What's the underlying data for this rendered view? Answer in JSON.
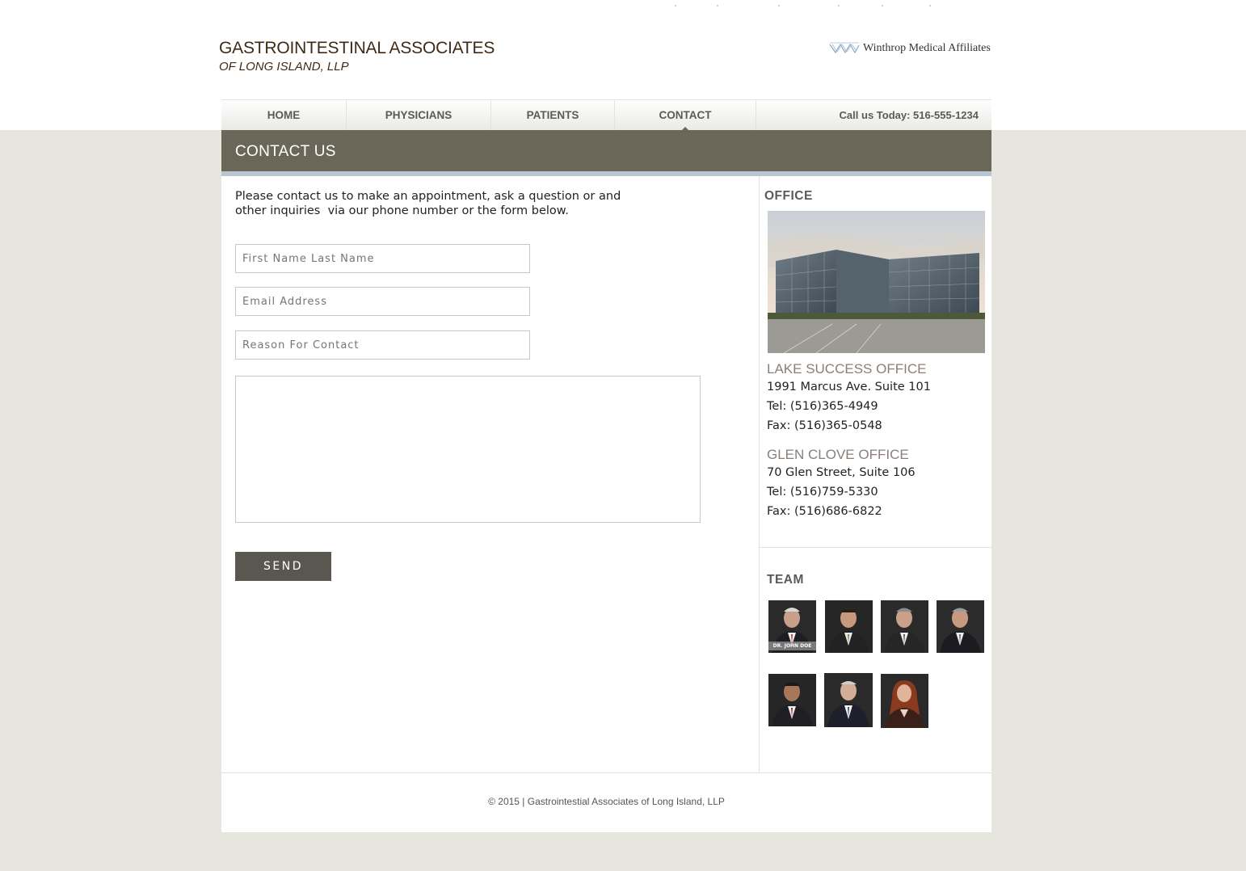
{
  "header": {
    "logo_line1": "GASTROINTESTINAL ASSOCIATES",
    "logo_line2": "OF LONG ISLAND, LLP",
    "affiliate": "Winthrop Medical Affiliates"
  },
  "nav": {
    "items": [
      {
        "label": "HOME"
      },
      {
        "label": "PHYSICIANS"
      },
      {
        "label": "PATIENTS"
      },
      {
        "label": "CONTACT"
      }
    ],
    "active": "CONTACT",
    "call": "Call us Today: 516-555-1234"
  },
  "page": {
    "title": "CONTACT US",
    "intro_line1": "Please contact us to make an appointment, ask a question or and",
    "intro_line2": "other inquiries  via our phone number or the form below."
  },
  "form": {
    "name_placeholder": "First Name Last Name",
    "email_placeholder": "Email Address",
    "reason_placeholder": "Reason For Contact",
    "message_value": "",
    "send_label": "SEND"
  },
  "sidebar": {
    "office_title": "OFFICE",
    "offices": [
      {
        "name": "LAKE SUCCESS OFFICE",
        "address": "1991 Marcus Ave. Suite 101",
        "tel": "Tel: (516)365-4949",
        "fax": "Fax: (516)365-0548"
      },
      {
        "name": "GLEN CLOVE OFFICE",
        "address": "70 Glen Street, Suite 106",
        "tel": "Tel: (516)759-5330",
        "fax": "Fax: (516)686-6822"
      }
    ],
    "team_title": "TEAM",
    "team_caption": "DR. JOHN  DOE"
  },
  "footer": {
    "text": "© 2015 | Gastrointestial Associates of Long Island, LLP"
  },
  "colors": {
    "header_bar": "#6a6658",
    "accent_bar": "#b7c6d0",
    "page_bg": "#e7e6de",
    "button": "#5a5650",
    "office_name": "#8a7f78"
  }
}
